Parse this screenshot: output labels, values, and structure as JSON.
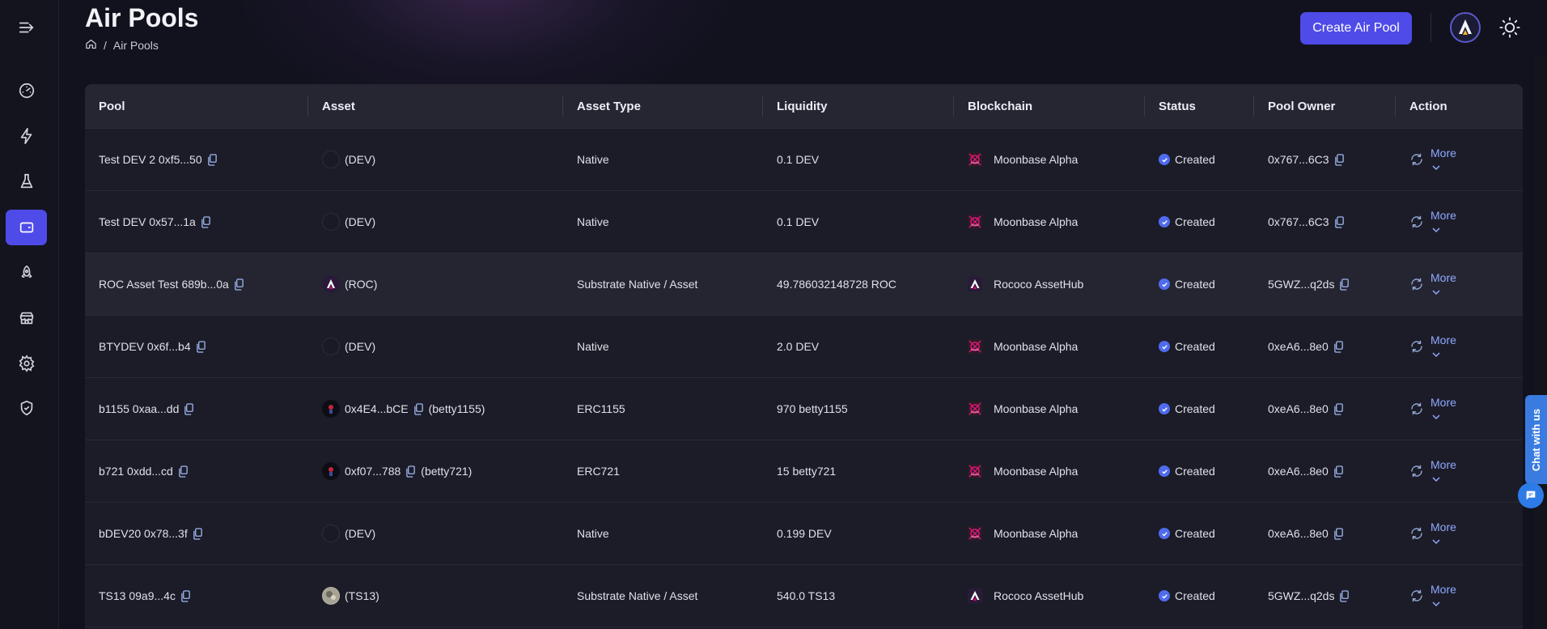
{
  "header": {
    "title": "Air Pools",
    "breadcrumb": {
      "current": "Air Pools"
    },
    "create_button": "Create Air Pool"
  },
  "sidebar": {
    "items": [
      {
        "icon": "collapse-menu-icon"
      },
      {
        "icon": "dashboard-icon"
      },
      {
        "icon": "lightning-icon"
      },
      {
        "icon": "flask-icon"
      },
      {
        "icon": "wallet-icon",
        "active": true
      },
      {
        "icon": "rocket-icon"
      },
      {
        "icon": "store-icon"
      },
      {
        "icon": "settings-icon"
      },
      {
        "icon": "shield-icon"
      }
    ]
  },
  "table": {
    "columns": [
      "Pool",
      "Asset",
      "Asset Type",
      "Liquidity",
      "Blockchain",
      "Status",
      "Pool Owner",
      "Action"
    ],
    "rows": [
      {
        "pool": "Test DEV 2 0xf5...50",
        "asset_address": "",
        "asset": "(DEV)",
        "asset_logo": "empty",
        "type": "Native",
        "liquidity": "0.1 DEV",
        "chain": "Moonbase Alpha",
        "chain_logo": "moonbase",
        "status": "Created",
        "owner": "0x767...6C3",
        "action": "More"
      },
      {
        "pool": "Test DEV 0x57...1a",
        "asset_address": "",
        "asset": "(DEV)",
        "asset_logo": "empty",
        "type": "Native",
        "liquidity": "0.1 DEV",
        "chain": "Moonbase Alpha",
        "chain_logo": "moonbase",
        "status": "Created",
        "owner": "0x767...6C3",
        "action": "More"
      },
      {
        "pool": "ROC Asset Test 689b...0a",
        "asset_address": "",
        "asset": "(ROC)",
        "asset_logo": "roc",
        "type": "Substrate Native / Asset",
        "liquidity": "49.786032148728 ROC",
        "chain": "Rococo AssetHub",
        "chain_logo": "rococo",
        "status": "Created",
        "owner": "5GWZ...q2ds",
        "action": "More"
      },
      {
        "pool": "BTYDEV 0x6f...b4",
        "asset_address": "",
        "asset": "(DEV)",
        "asset_logo": "empty",
        "type": "Native",
        "liquidity": "2.0 DEV",
        "chain": "Moonbase Alpha",
        "chain_logo": "moonbase",
        "status": "Created",
        "owner": "0xeA6...8e0",
        "action": "More"
      },
      {
        "pool": "b1155 0xaa...dd",
        "asset_address": "0x4E4...bCE",
        "asset": "(betty1155)",
        "asset_logo": "dark",
        "type": "ERC1155",
        "liquidity": "970 betty1155",
        "chain": "Moonbase Alpha",
        "chain_logo": "moonbase",
        "status": "Created",
        "owner": "0xeA6...8e0",
        "action": "More"
      },
      {
        "pool": "b721 0xdd...cd",
        "asset_address": "0xf07...788",
        "asset": "(betty721)",
        "asset_logo": "dark",
        "type": "ERC721",
        "liquidity": "15 betty721",
        "chain": "Moonbase Alpha",
        "chain_logo": "moonbase",
        "status": "Created",
        "owner": "0xeA6...8e0",
        "action": "More"
      },
      {
        "pool": "bDEV20 0x78...3f",
        "asset_address": "",
        "asset": "(DEV)",
        "asset_logo": "empty",
        "type": "Native",
        "liquidity": "0.199 DEV",
        "chain": "Moonbase Alpha",
        "chain_logo": "moonbase",
        "status": "Created",
        "owner": "0xeA6...8e0",
        "action": "More"
      },
      {
        "pool": "TS13 09a9...4c",
        "asset_address": "",
        "asset": "(TS13)",
        "asset_logo": "ts",
        "type": "Substrate Native / Asset",
        "liquidity": "540.0 TS13",
        "chain": "Rococo AssetHub",
        "chain_logo": "rococo",
        "status": "Created",
        "owner": "5GWZ...q2ds",
        "action": "More"
      }
    ]
  },
  "chat": {
    "label": "Chat with us"
  },
  "colors": {
    "accent": "#4f4be8",
    "status": "#4f6bed",
    "link": "#8fa8ff"
  }
}
